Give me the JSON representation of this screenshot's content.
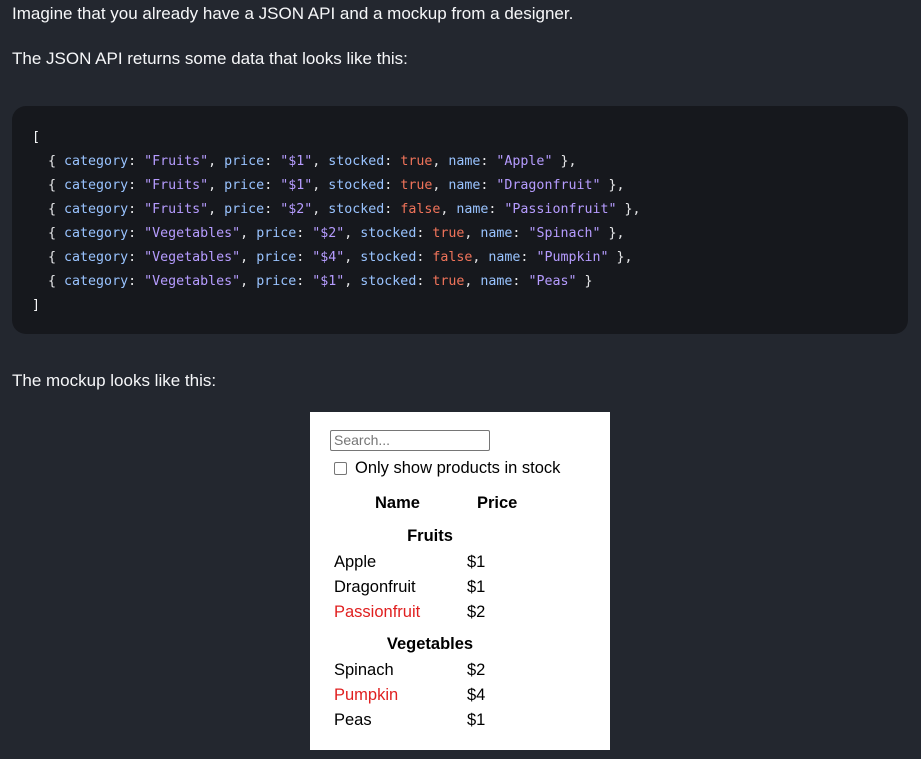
{
  "intro": {
    "p1": "Imagine that you already have a JSON API and a mockup from a designer.",
    "p2": "The JSON API returns some data that looks like this:",
    "p3": "The mockup looks like this:"
  },
  "code": {
    "open_bracket": "[",
    "close_bracket": "]",
    "rows": [
      {
        "category": "\"Fruits\"",
        "price": "\"$1\"",
        "stocked": "true",
        "name": "\"Apple\""
      },
      {
        "category": "\"Fruits\"",
        "price": "\"$1\"",
        "stocked": "true",
        "name": "\"Dragonfruit\""
      },
      {
        "category": "\"Fruits\"",
        "price": "\"$2\"",
        "stocked": "false",
        "name": "\"Passionfruit\""
      },
      {
        "category": "\"Vegetables\"",
        "price": "\"$2\"",
        "stocked": "true",
        "name": "\"Spinach\""
      },
      {
        "category": "\"Vegetables\"",
        "price": "\"$4\"",
        "stocked": "false",
        "name": "\"Pumpkin\""
      },
      {
        "category": "\"Vegetables\"",
        "price": "\"$1\"",
        "stocked": "true",
        "name": "\"Peas\""
      }
    ],
    "keys": {
      "category": "category",
      "price": "price",
      "stocked": "stocked",
      "name": "name"
    }
  },
  "mockup": {
    "search_placeholder": "Search...",
    "checkbox_label": "Only show products in stock",
    "header_name": "Name",
    "header_price": "Price",
    "categories": [
      {
        "title": "Fruits",
        "items": [
          {
            "name": "Apple",
            "price": "$1",
            "stocked": true
          },
          {
            "name": "Dragonfruit",
            "price": "$1",
            "stocked": true
          },
          {
            "name": "Passionfruit",
            "price": "$2",
            "stocked": false
          }
        ]
      },
      {
        "title": "Vegetables",
        "items": [
          {
            "name": "Spinach",
            "price": "$2",
            "stocked": true
          },
          {
            "name": "Pumpkin",
            "price": "$4",
            "stocked": false
          },
          {
            "name": "Peas",
            "price": "$1",
            "stocked": true
          }
        ]
      }
    ]
  },
  "colors": {
    "background": "#23272f",
    "code_background": "#16181d",
    "out_of_stock": "#e02020"
  }
}
